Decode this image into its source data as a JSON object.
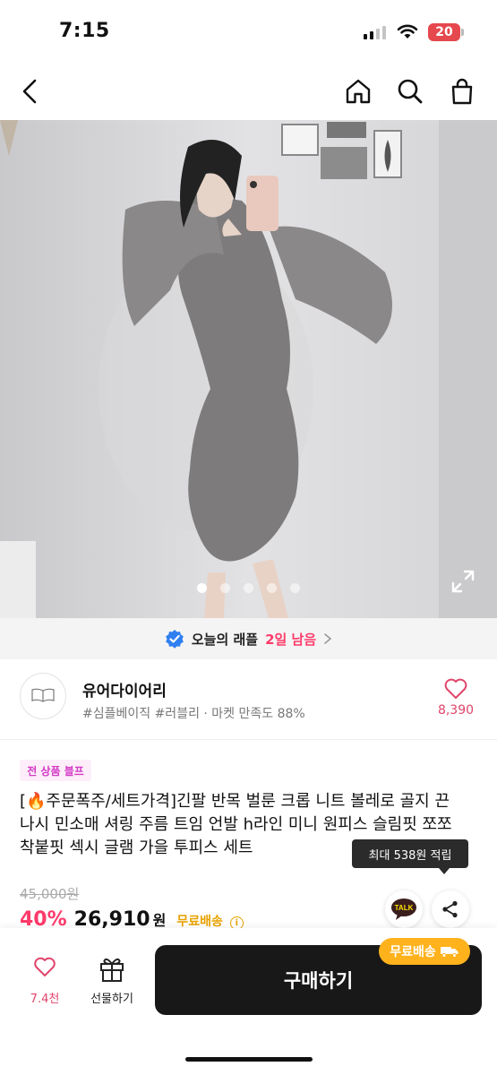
{
  "status_bar": {
    "time": "7:15",
    "battery": "20"
  },
  "nav": {
    "back_icon": "chevron-left-icon",
    "home_icon": "home-icon",
    "search_icon": "search-icon",
    "bag_icon": "shopping-bag-icon"
  },
  "carousel": {
    "total": 5,
    "active_index": 0
  },
  "raffle": {
    "label": "오늘의 래플",
    "remaining": "2일 남음"
  },
  "seller": {
    "name": "유어다이어리",
    "tags": "#심플베이직 #러블리 · 마켓 만족도 88%",
    "likes": "8,390"
  },
  "product": {
    "promo_badge": "전 상품 블프",
    "title": "[🔥주문폭주/세트가격]긴팔 반목 벌룬 크롭 니트 볼레로 골지 끈 나시 민소매 셔링 주름 트임 언발 h라인 미니 원피스 슬림핏 쪼쪼 착붙핏 섹시 글램 가을 투피스 세트",
    "points_tooltip": "최대 538원 적립",
    "original_price": "45,000원",
    "discount": "40%",
    "price": "26,910",
    "currency": "원",
    "shipping": "무료배송",
    "talk_label": "TALK"
  },
  "bottom_bar": {
    "like_count": "7.4천",
    "gift_label": "선물하기",
    "buy_label": "구매하기",
    "ship_badge": "무료배송"
  },
  "colors": {
    "accent_pink": "#ff3b6b",
    "shipping_yellow": "#ffb21c",
    "buy_button": "#181818"
  }
}
